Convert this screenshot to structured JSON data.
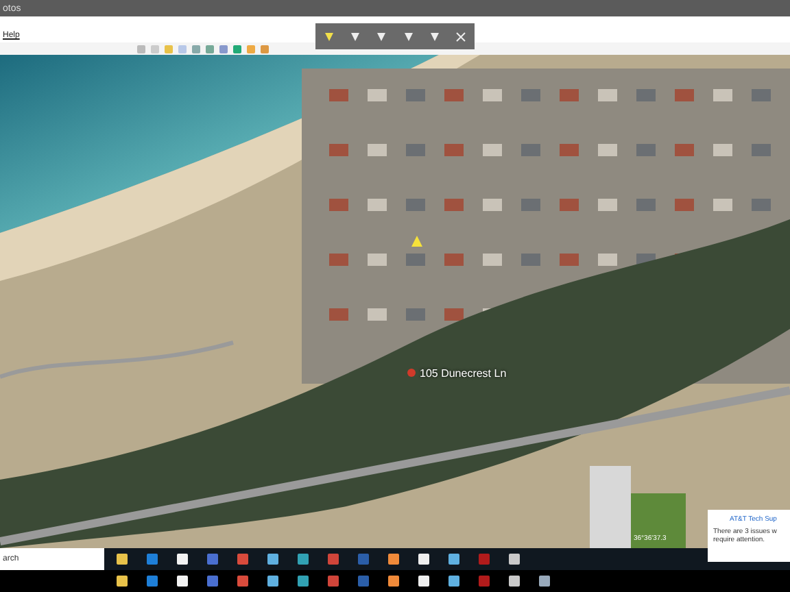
{
  "window": {
    "title": "otos"
  },
  "menu": [
    {
      "label": "Help"
    }
  ],
  "map": {
    "labels": [
      {
        "text": "105 Dunecrest Ln",
        "kind": "pin"
      }
    ],
    "coordinates": "36°36'37.3"
  },
  "notification": {
    "title": "AT&T Tech Sup",
    "body": "There are 3 issues w\nrequire attention."
  },
  "taskbar": {
    "search": {
      "placeholder": "arch"
    },
    "apps_top": [
      {
        "kind": "folder"
      },
      {
        "kind": "edge"
      },
      {
        "kind": "store"
      },
      {
        "kind": "tool"
      },
      {
        "kind": "chrome"
      },
      {
        "kind": "photo"
      },
      {
        "kind": "globe"
      },
      {
        "kind": "mail"
      },
      {
        "kind": "word"
      },
      {
        "kind": "media"
      },
      {
        "kind": "envelope"
      },
      {
        "kind": "photo"
      },
      {
        "kind": "pdf"
      },
      {
        "kind": "earth"
      }
    ],
    "apps_bottom": [
      {
        "kind": "folder"
      },
      {
        "kind": "edge"
      },
      {
        "kind": "store"
      },
      {
        "kind": "tool"
      },
      {
        "kind": "chrome"
      },
      {
        "kind": "photo"
      },
      {
        "kind": "globe"
      },
      {
        "kind": "mail"
      },
      {
        "kind": "word"
      },
      {
        "kind": "media"
      },
      {
        "kind": "envelope"
      },
      {
        "kind": "photo"
      },
      {
        "kind": "pdf"
      },
      {
        "kind": "earth"
      },
      {
        "kind": "picture"
      }
    ]
  }
}
